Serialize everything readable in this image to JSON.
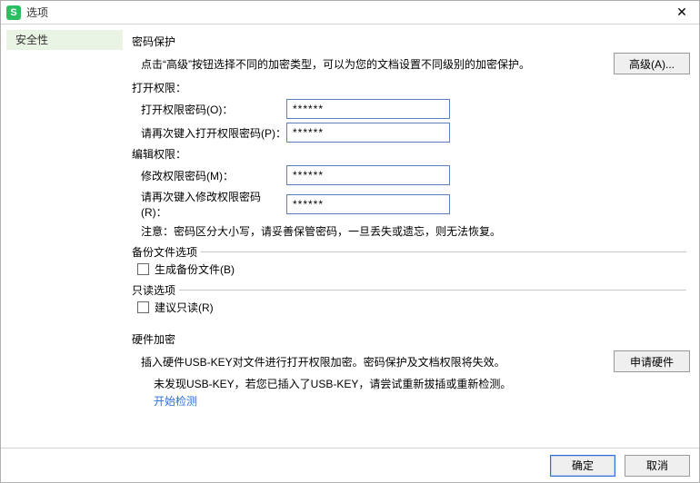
{
  "titlebar": {
    "title": "选项",
    "close": "✕"
  },
  "sidebar": {
    "items": [
      {
        "label": "安全性"
      }
    ]
  },
  "content": {
    "password_protection": {
      "title": "密码保护",
      "hint": "点击“高级”按钮选择不同的加密类型，可以为您的文档设置不同级别的加密保护。",
      "advanced_btn": "高级(A)..."
    },
    "open_perm": {
      "title": "打开权限：",
      "pwd_label": "打开权限密码(O)：",
      "pwd_value": "******",
      "pwd2_label": "请再次键入打开权限密码(P)：",
      "pwd2_value": "******"
    },
    "edit_perm": {
      "title": "编辑权限：",
      "pwd_label": "修改权限密码(M)：",
      "pwd_value": "******",
      "pwd2_label": "请再次键入修改权限密码(R)：",
      "pwd2_value": "******"
    },
    "note": "注意：密码区分大小写，请妥善保管密码，一旦丢失或遗忘，则无法恢复。",
    "backup": {
      "legend": "备份文件选项",
      "checkbox_label": "生成备份文件(B)"
    },
    "readonly": {
      "legend": "只读选项",
      "checkbox_label": "建议只读(R)"
    },
    "hardware": {
      "title": "硬件加密",
      "line1": "插入硬件USB-KEY对文件进行打开权限加密。密码保护及文档权限将失效。",
      "line2": "未发现USB-KEY，若您已插入了USB-KEY，请尝试重新拔插或重新检测。",
      "link": "开始检测",
      "apply_btn": "申请硬件"
    }
  },
  "footer": {
    "ok": "确定",
    "cancel": "取消"
  }
}
